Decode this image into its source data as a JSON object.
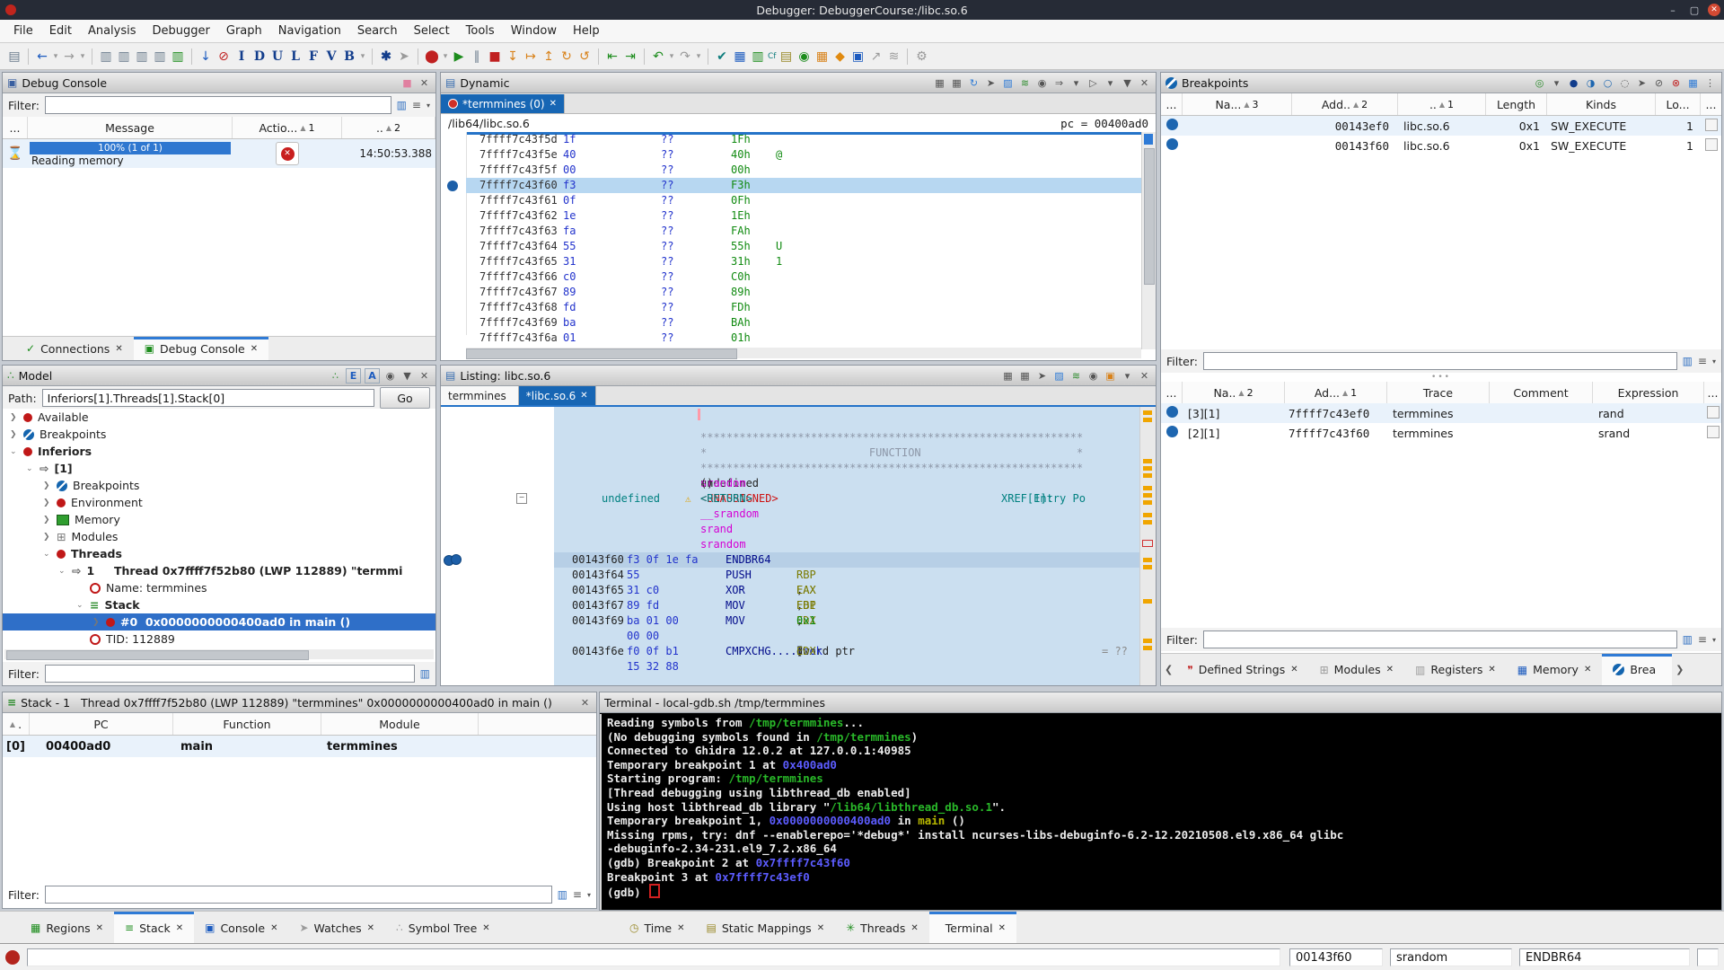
{
  "window": {
    "title": "Debugger: DebuggerCourse:/libc.so.6",
    "controls": {
      "minimize": "–",
      "maximize": "▢",
      "close": "✕"
    }
  },
  "menu": [
    {
      "label": "File"
    },
    {
      "label": "Edit"
    },
    {
      "label": "Analysis"
    },
    {
      "label": "Debugger"
    },
    {
      "label": "Graph"
    },
    {
      "label": "Navigation"
    },
    {
      "label": "Search"
    },
    {
      "label": "Select"
    },
    {
      "label": "Tools"
    },
    {
      "label": "Window"
    },
    {
      "label": "Help"
    }
  ],
  "toolbar": [
    {
      "n": "save-icon",
      "g": "▤",
      "cls": "c-steel"
    },
    {
      "sep": true
    },
    {
      "n": "back-icon",
      "g": "←",
      "cls": "c-blue"
    },
    {
      "n": "back-dropdown-icon",
      "g": "▾",
      "cls": "c-dim tiny"
    },
    {
      "n": "forward-icon",
      "g": "→",
      "cls": "c-dim"
    },
    {
      "n": "forward-dropdown-icon",
      "g": "▾",
      "cls": "c-dim tiny"
    },
    {
      "sep": true
    },
    {
      "n": "clear-code-icon",
      "g": "▥",
      "cls": "c-steel"
    },
    {
      "n": "copy-special-icon",
      "g": "▥",
      "cls": "c-steel"
    },
    {
      "n": "paste-special-icon",
      "g": "▥",
      "cls": "c-steel"
    },
    {
      "n": "patch-icon",
      "g": "▥",
      "cls": "c-steel"
    },
    {
      "n": "assemble-icon",
      "g": "▥",
      "cls": "c-green"
    },
    {
      "sep": true
    },
    {
      "n": "pulldown-icon",
      "g": "↓",
      "cls": "c-blue"
    },
    {
      "n": "clear-flow-icon",
      "g": "⊘",
      "cls": "c-red"
    },
    {
      "n": "datatype-i-icon",
      "g": "I",
      "cls": "c-navy"
    },
    {
      "n": "datatype-d-icon",
      "g": "D",
      "cls": "c-navy"
    },
    {
      "n": "datatype-u-icon",
      "g": "U",
      "cls": "c-navy"
    },
    {
      "n": "datatype-l-icon",
      "g": "L",
      "cls": "c-navy"
    },
    {
      "n": "datatype-f-icon",
      "g": "F",
      "cls": "c-navy"
    },
    {
      "n": "datatype-v-icon",
      "g": "V",
      "cls": "c-navy"
    },
    {
      "n": "datatype-b-icon",
      "g": "B",
      "cls": "c-navy"
    },
    {
      "n": "datatype-dropdown-icon",
      "g": "▾",
      "cls": "c-dim tiny"
    },
    {
      "sep": true
    },
    {
      "n": "analyze-icon",
      "g": "✱",
      "cls": "c-navy"
    },
    {
      "n": "pointer-icon",
      "g": "➤",
      "cls": "c-dim"
    },
    {
      "sep": true
    },
    {
      "n": "record-icon",
      "g": "⬤",
      "cls": "c-red"
    },
    {
      "n": "record-dropdown-icon",
      "g": "▾",
      "cls": "c-dim tiny"
    },
    {
      "n": "resume-icon",
      "g": "▶",
      "cls": "c-green"
    },
    {
      "n": "interrupt-icon",
      "g": "∥",
      "cls": "c-steel"
    },
    {
      "n": "kill-icon",
      "g": "■",
      "cls": "c-red"
    },
    {
      "n": "step-into-icon",
      "g": "↧",
      "cls": "c-amber"
    },
    {
      "n": "step-over-icon",
      "g": "↦",
      "cls": "c-amber"
    },
    {
      "n": "step-out-icon",
      "g": "↥",
      "cls": "c-amber"
    },
    {
      "n": "step-last-icon",
      "g": "↻",
      "cls": "c-amber"
    },
    {
      "n": "step-back-icon",
      "g": "↺",
      "cls": "c-amber"
    },
    {
      "sep": true
    },
    {
      "n": "go-previous-icon",
      "g": "⇤",
      "cls": "c-green"
    },
    {
      "n": "go-next-icon",
      "g": "⇥",
      "cls": "c-green"
    },
    {
      "sep": true
    },
    {
      "n": "undo-icon",
      "g": "↶",
      "cls": "c-green"
    },
    {
      "n": "undo-dropdown-icon",
      "g": "▾",
      "cls": "c-dim tiny"
    },
    {
      "n": "redo-icon",
      "g": "↷",
      "cls": "c-dim"
    },
    {
      "n": "redo-dropdown-icon",
      "g": "▾",
      "cls": "c-dim tiny"
    },
    {
      "sep": true
    },
    {
      "n": "validate-icon",
      "g": "✔",
      "cls": "c-teal"
    },
    {
      "n": "table-icon",
      "g": "▦",
      "cls": "c-blue"
    },
    {
      "n": "listing-compare-icon",
      "g": "▥",
      "cls": "c-green"
    },
    {
      "n": "function-compare-icon",
      "g": "Cf",
      "cls": "c-teal tiny"
    },
    {
      "n": "datatype-manager-icon",
      "g": "▤",
      "cls": "c-olive"
    },
    {
      "n": "decompile-icon",
      "g": "◉",
      "cls": "c-green"
    },
    {
      "n": "memory-map-icon",
      "g": "▦",
      "cls": "c-amber"
    },
    {
      "n": "diamond-icon",
      "g": "◆",
      "cls": "c-orange"
    },
    {
      "n": "window-icon",
      "g": "▣",
      "cls": "c-blue"
    },
    {
      "n": "export-icon",
      "g": "↗",
      "cls": "c-dim"
    },
    {
      "n": "graph-icon",
      "g": "≋",
      "cls": "c-dim"
    },
    {
      "sep": true
    },
    {
      "n": "settings-icon",
      "g": "⚙",
      "cls": "c-dim"
    }
  ],
  "console": {
    "title": "Debug Console",
    "filter_label": "Filter:",
    "headers": {
      "c1": "...",
      "c2": "Message",
      "c3": "Actio...",
      "c3n": "1",
      "c4": "..",
      "c4n": "2"
    },
    "row": {
      "progress": "100% (1 of 1)",
      "message": "Reading memory",
      "time": "14:50:53.388"
    },
    "tabs": [
      {
        "n": "tab-connections",
        "label": "Connections",
        "icon": "✓",
        "cls": ""
      },
      {
        "n": "tab-debug-console",
        "label": "Debug Console",
        "icon": "▣",
        "cls": "sel"
      }
    ]
  },
  "dynamic": {
    "title": "Dynamic",
    "tab": "*termmines (0)",
    "module_path": "/lib64/libc.so.6",
    "pc_label": "pc = 00400ad0",
    "rows": [
      {
        "a": "7ffff7c43f5d",
        "b": "1f",
        "q": "??",
        "v": "1Fh",
        "ch": ""
      },
      {
        "a": "7ffff7c43f5e",
        "b": "40",
        "q": "??",
        "v": "40h",
        "ch": "@"
      },
      {
        "a": "7ffff7c43f5f",
        "b": "00",
        "q": "??",
        "v": "00h",
        "ch": ""
      },
      {
        "a": "7ffff7c43f60",
        "b": "f3",
        "q": "??",
        "v": "F3h",
        "ch": "",
        "cls": "sel"
      },
      {
        "a": "7ffff7c43f61",
        "b": "0f",
        "q": "??",
        "v": "0Fh",
        "ch": ""
      },
      {
        "a": "7ffff7c43f62",
        "b": "1e",
        "q": "??",
        "v": "1Eh",
        "ch": ""
      },
      {
        "a": "7ffff7c43f63",
        "b": "fa",
        "q": "??",
        "v": "FAh",
        "ch": ""
      },
      {
        "a": "7ffff7c43f64",
        "b": "55",
        "q": "??",
        "v": "55h",
        "ch": "U"
      },
      {
        "a": "7ffff7c43f65",
        "b": "31",
        "q": "??",
        "v": "31h",
        "ch": "1"
      },
      {
        "a": "7ffff7c43f66",
        "b": "c0",
        "q": "??",
        "v": "C0h",
        "ch": ""
      },
      {
        "a": "7ffff7c43f67",
        "b": "89",
        "q": "??",
        "v": "89h",
        "ch": ""
      },
      {
        "a": "7ffff7c43f68",
        "b": "fd",
        "q": "??",
        "v": "FDh",
        "ch": ""
      },
      {
        "a": "7ffff7c43f69",
        "b": "ba",
        "q": "??",
        "v": "BAh",
        "ch": ""
      },
      {
        "a": "7ffff7c43f6a",
        "b": "01",
        "q": "??",
        "v": "01h",
        "ch": ""
      }
    ]
  },
  "breakpoints": {
    "title": "Breakpoints",
    "filter_label": "Filter:",
    "t1_headers": {
      "c1": "...",
      "name": "Na...",
      "name_n": "3",
      "addr": "Add..",
      "addr_n": "2",
      "mod": "..",
      "mod_n": "1",
      "len": "Length",
      "kinds": "Kinds",
      "lo": "Lo...",
      "c8": "..."
    },
    "t1_rows": [
      {
        "address": "00143ef0",
        "module": "libc.so.6",
        "length": "0x1",
        "kinds": "SW_EXECUTE",
        "locations": "1",
        "cls": "rowblue"
      },
      {
        "address": "00143f60",
        "module": "libc.so.6",
        "length": "0x1",
        "kinds": "SW_EXECUTE",
        "locations": "1",
        "cls": ""
      }
    ],
    "t2_headers": {
      "c1": "...",
      "name": "Na..",
      "name_n": "2",
      "addr": "Ad...",
      "addr_n": "1",
      "trace": "Trace",
      "comment": "Comment",
      "expr": "Expression",
      "c7": "..."
    },
    "t2_rows": [
      {
        "name": "[3][1]",
        "address": "7ffff7c43ef0",
        "trace": "termmines",
        "comment": "",
        "expr": "rand",
        "cls": "rowblue"
      },
      {
        "name": "[2][1]",
        "address": "7ffff7c43f60",
        "trace": "termmines",
        "comment": "",
        "expr": "srand",
        "cls": ""
      }
    ],
    "dock_tabs": [
      {
        "n": "tab-defined-strings",
        "label": "Defined Strings",
        "icon": "❞",
        "icls": "c-red",
        "x": "✕",
        "cls": ""
      },
      {
        "n": "tab-modules",
        "label": "Modules",
        "icon": "⊞",
        "icls": "c-dim",
        "x": "✕",
        "cls": ""
      },
      {
        "n": "tab-registers",
        "label": "Registers",
        "icon": "▥",
        "icls": "c-dim",
        "x": "✕",
        "cls": ""
      },
      {
        "n": "tab-memory",
        "label": "Memory",
        "icon": "▦",
        "icls": "c-blue",
        "x": "✕",
        "cls": ""
      },
      {
        "n": "tab-breakpoints",
        "label": "Brea",
        "icon": "",
        "icls": "bpdot",
        "x": "",
        "cls": "sel"
      }
    ]
  },
  "model": {
    "title": "Model",
    "path_label": "Path:",
    "path_value": "Inferiors[1].Threads[1].Stack[0]",
    "go_label": "Go",
    "filter_label": "Filter:",
    "tree": [
      {
        "cls": "ind0",
        "exp": "❯",
        "icon": "ic-reddot",
        "label": "Available"
      },
      {
        "cls": "ind0",
        "exp": "❯",
        "icon": "ic-bpc",
        "label": "Breakpoints"
      },
      {
        "cls": "ind0 bold",
        "exp": "⌄",
        "icon": "ic-reddot",
        "label": "Inferiors"
      },
      {
        "cls": "ind1 bold",
        "exp": "⌄",
        "icon": "ic-arrow",
        "label": "[1]"
      },
      {
        "cls": "ind2",
        "exp": "❯",
        "icon": "ic-bpc",
        "label": "Breakpoints"
      },
      {
        "cls": "ind2",
        "exp": "❯",
        "icon": "ic-reddot",
        "label": "Environment"
      },
      {
        "cls": "ind2",
        "exp": "❯",
        "icon": "ic-mem",
        "label": "Memory"
      },
      {
        "cls": "ind2",
        "exp": "❯",
        "icon": "ic-mod",
        "label": "Modules"
      },
      {
        "cls": "ind2 bold",
        "exp": "⌄",
        "icon": "ic-reddot",
        "label": "Threads"
      },
      {
        "cls": "ind3 bold",
        "exp": "⌄",
        "icon": "ic-arrow",
        "label": "1     Thread 0x7ffff7f52b80 (LWP 112889) \"termmi"
      },
      {
        "cls": "ind4",
        "exp": "",
        "icon": "ic-ring",
        "label": "Name: termmines"
      },
      {
        "cls": "ind4 bold",
        "exp": "⌄",
        "icon": "ic-stack",
        "label": "Stack"
      },
      {
        "cls": "ind5 selrow",
        "exp": "❯",
        "icon": "ic-reddot",
        "label": "#0  0x0000000000400ad0 in main ()"
      },
      {
        "cls": "ind4",
        "exp": "",
        "icon": "ic-ring",
        "label": "TID: 112889"
      }
    ]
  },
  "listing": {
    "title": "Listing: libc.so.6",
    "tabs": [
      {
        "n": "tab-termmines",
        "label": "termmines",
        "cls": ""
      },
      {
        "n": "tab-libc",
        "label": "*libc.so.6",
        "cls": "sel",
        "x": "✕"
      }
    ],
    "lines": {
      "comment_top": "***********************************************************",
      "function_line": "*                         FUNCTION                        *",
      "comment_bottom": "***********************************************************",
      "signature": [
        [
          "undefined ",
          "drk"
        ],
        [
          "srandom",
          "mag"
        ],
        [
          "()",
          "drk"
        ]
      ],
      "rettype": "undefined",
      "warn": "⚠",
      "unassigned": [
        [
          "<UNASSIGNED>",
          "red"
        ],
        [
          "   ",
          "p"
        ],
        [
          "<RETURN>",
          "teal"
        ]
      ],
      "xref": [
        [
          "XREF[1]:",
          "teal"
        ],
        [
          "     Entry Po",
          "teal"
        ]
      ],
      "label1": "__srandom",
      "label2": "srand",
      "label3": "srandom"
    },
    "asm": [
      {
        "addr": "00143f60",
        "bytes": "f3 0f 1e fa",
        "mnem": "ENDBR64",
        "ops": [],
        "cls": "sel"
      },
      {
        "addr": "00143f64",
        "bytes": "55",
        "mnem": "PUSH",
        "ops": [
          [
            "RBP",
            "reg"
          ]
        ]
      },
      {
        "addr": "00143f65",
        "bytes": "31 c0",
        "mnem": "XOR",
        "ops": [
          [
            "EAX",
            "reg"
          ],
          [
            ",",
            "p"
          ],
          [
            "EAX",
            "reg"
          ]
        ]
      },
      {
        "addr": "00143f67",
        "bytes": "89 fd",
        "mnem": "MOV",
        "ops": [
          [
            "EBP",
            "reg"
          ],
          [
            ",",
            "p"
          ],
          [
            "EDI",
            "reg"
          ]
        ]
      },
      {
        "addr": "00143f69",
        "bytes": "ba 01 00",
        "mnem": "MOV",
        "ops": [
          [
            "EDX",
            "reg"
          ],
          [
            ",",
            "p"
          ],
          [
            "0x1",
            "imm"
          ]
        ]
      },
      {
        "addr": "",
        "bytes": "00 00",
        "mnem": "",
        "ops": []
      },
      {
        "addr": "00143f6e",
        "bytes": "f0 0f b1",
        "mnem": "CMPXCHG....",
        "ops": [
          [
            "dword ptr ",
            "p"
          ],
          [
            "[",
            "p"
          ],
          [
            "lock",
            "blu"
          ],
          [
            "]",
            "p"
          ],
          [
            ",",
            "p"
          ],
          [
            "EDX",
            "reg"
          ]
        ],
        "note": "= ??"
      },
      {
        "addr": "",
        "bytes": "15 32 88",
        "mnem": "",
        "ops": []
      }
    ]
  },
  "stack": {
    "title": "Stack - 1   Thread 0x7ffff7f52b80 (LWP 112889) \"termmines\" 0x0000000000400ad0 in main ()",
    "headers": {
      "c1": ".",
      "pc": "PC",
      "fn": "Function",
      "mod": "Module"
    },
    "row": {
      "level": "[0]",
      "pc": "00400ad0",
      "fn": "main",
      "mod": "termmines"
    },
    "filter_label": "Filter:"
  },
  "terminal": {
    "title": "Terminal - local-gdb.sh /tmp/termmines",
    "lines": [
      {
        "segs": [
          [
            "Reading symbols from ",
            "w"
          ],
          [
            "/tmp/termmines",
            "g"
          ],
          [
            "...",
            "w"
          ]
        ]
      },
      {
        "segs": [
          [
            "(No debugging symbols found in ",
            "w"
          ],
          [
            "/tmp/termmines",
            "g"
          ],
          [
            ")",
            "w"
          ]
        ]
      },
      {
        "segs": [
          [
            "Connected to Ghidra 12.0.2 at 127.0.0.1:40985",
            "w"
          ]
        ]
      },
      {
        "segs": [
          [
            "Temporary breakpoint 1 at ",
            "w"
          ],
          [
            "0x400ad0",
            "b"
          ]
        ]
      },
      {
        "segs": [
          [
            "Starting program: ",
            "w"
          ],
          [
            "/tmp/termmines",
            "g"
          ]
        ]
      },
      {
        "segs": [
          [
            "[Thread debugging using libthread_db enabled]",
            "w"
          ]
        ]
      },
      {
        "segs": [
          [
            "Using host libthread_db library \"",
            "w"
          ],
          [
            "/lib64/libthread_db.so.1",
            "g"
          ],
          [
            "\".",
            "w"
          ]
        ]
      },
      {
        "segs": []
      },
      {
        "segs": [
          [
            "Temporary breakpoint 1, ",
            "w"
          ],
          [
            "0x0000000000400ad0",
            "b"
          ],
          [
            " in ",
            "w"
          ],
          [
            "main",
            "y"
          ],
          [
            " ()",
            "w"
          ]
        ]
      },
      {
        "segs": [
          [
            "Missing rpms, try: dnf --enablerepo='*debug*' install ncurses-libs-debuginfo-6.2-12.20210508.el9.x86_64 glibc",
            "w"
          ]
        ]
      },
      {
        "segs": [
          [
            "-debuginfo-2.34-231.el9_7.2.x86_64",
            "w"
          ]
        ]
      },
      {
        "segs": [
          [
            "(gdb) Breakpoint 2 at ",
            "w"
          ],
          [
            "0x7ffff7c43f60",
            "b"
          ]
        ]
      },
      {
        "segs": [
          [
            "Breakpoint 3 at ",
            "w"
          ],
          [
            "0x7ffff7c43ef0",
            "b"
          ]
        ]
      },
      {
        "segs": [
          [
            "(gdb) ",
            "w"
          ],
          [
            "",
            "cur"
          ]
        ]
      }
    ]
  },
  "bottom_tabs_left": [
    {
      "n": "tab-regions",
      "label": "Regions",
      "icon": "▦",
      "icls": "c-green",
      "x": "✕",
      "cls": ""
    },
    {
      "n": "tab-stack",
      "label": "Stack",
      "icon": "≡",
      "icls": "c-green",
      "x": "✕",
      "cls": "sel"
    },
    {
      "n": "tab-console",
      "label": "Console",
      "icon": "▣",
      "icls": "c-blue",
      "x": "✕",
      "cls": ""
    },
    {
      "n": "tab-watches",
      "label": "Watches",
      "icon": "➤",
      "icls": "c-dim",
      "x": "✕",
      "cls": ""
    },
    {
      "n": "tab-symbol-tree",
      "label": "Symbol Tree",
      "icon": "∴",
      "icls": "c-dim",
      "x": "✕",
      "cls": ""
    }
  ],
  "bottom_tabs_mid": [
    {
      "n": "tab-time",
      "label": "Time",
      "icon": "◷",
      "icls": "c-olive",
      "x": "✕",
      "cls": ""
    },
    {
      "n": "tab-static-mappings",
      "label": "Static Mappings",
      "icon": "▤",
      "icls": "c-olive",
      "x": "✕",
      "cls": ""
    },
    {
      "n": "tab-threads",
      "label": "Threads",
      "icon": "✳",
      "icls": "c-green",
      "x": "✕",
      "cls": ""
    },
    {
      "n": "tab-terminal",
      "label": "Terminal",
      "icon": "",
      "icls": "",
      "x": "✕",
      "cls": "sel"
    }
  ],
  "status": {
    "address": "00143f60",
    "symbol": "srandom",
    "instruction": "ENDBR64"
  },
  "colors": {
    "accent_blue": "#2f7bd6",
    "selection_blue": "#2f6fc8",
    "tab_blue": "#1766b4",
    "breakpoint_blue": "#1d66b0",
    "terminal_green": "#29b829",
    "terminal_blue": "#5c5cff",
    "close_red": "#d34a33"
  }
}
